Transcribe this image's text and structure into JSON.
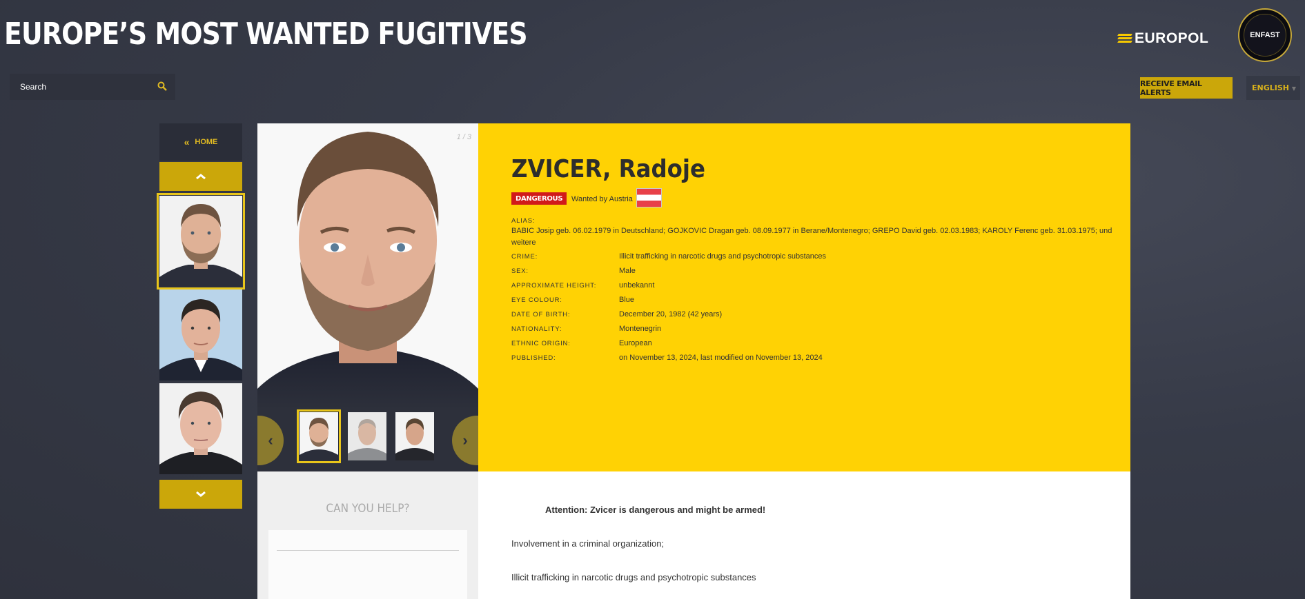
{
  "header": {
    "title": "EUROPE’S MOST WANTED FUGITIVES",
    "europol_logo": "EUROPOL",
    "enfast_logo": "ENFAST"
  },
  "search": {
    "placeholder": "Search"
  },
  "actions": {
    "alerts_label": "RECEIVE EMAIL ALERTS",
    "language": "ENGLISH"
  },
  "nav": {
    "home_label": "HOME",
    "home_icon": "double-chevron-left-icon"
  },
  "photo": {
    "counter": "1 / 3"
  },
  "profile": {
    "name": "ZVICER, Radoje",
    "badge": "DANGEROUS",
    "wanted_by": "Wanted by Austria",
    "flag_colors": [
      "#e84049",
      "#ffffff",
      "#e84049"
    ],
    "alias_label": "ALIAS:",
    "alias_value": "BABIC Josip geb. 06.02.1979 in Deutschland; GOJKOVIC Dragan geb. 08.09.1977 in Berane/Montenegro; GREPO David geb. 02.03.1983; KAROLY Ferenc geb. 31.03.1975; und weitere",
    "fields": [
      {
        "label": "CRIME:",
        "value": "Illicit trafficking in narcotic drugs and psychotropic substances"
      },
      {
        "label": "SEX:",
        "value": "Male"
      },
      {
        "label": "APPROXIMATE HEIGHT:",
        "value": "unbekannt"
      },
      {
        "label": "EYE COLOUR:",
        "value": "Blue"
      },
      {
        "label": "DATE OF BIRTH:",
        "value": "December 20, 1982 (42 years)"
      },
      {
        "label": "NATIONALITY:",
        "value": "Montenegrin"
      },
      {
        "label": "ETHNIC ORIGIN:",
        "value": "European"
      },
      {
        "label": "PUBLISHED:",
        "value": "on November 13, 2024, last modified on November 13, 2024"
      }
    ]
  },
  "help": {
    "title": "CAN YOU HELP?"
  },
  "body": {
    "attention": "Attention: Zvicer is dangerous and might be armed!",
    "line1": "Involvement in a criminal organization;",
    "line2": "Illicit trafficking in narcotic drugs and psychotropic substances"
  },
  "colors": {
    "accent": "#ffd204",
    "button": "#cba70a",
    "danger": "#d11a1a",
    "background": "#363a47"
  }
}
